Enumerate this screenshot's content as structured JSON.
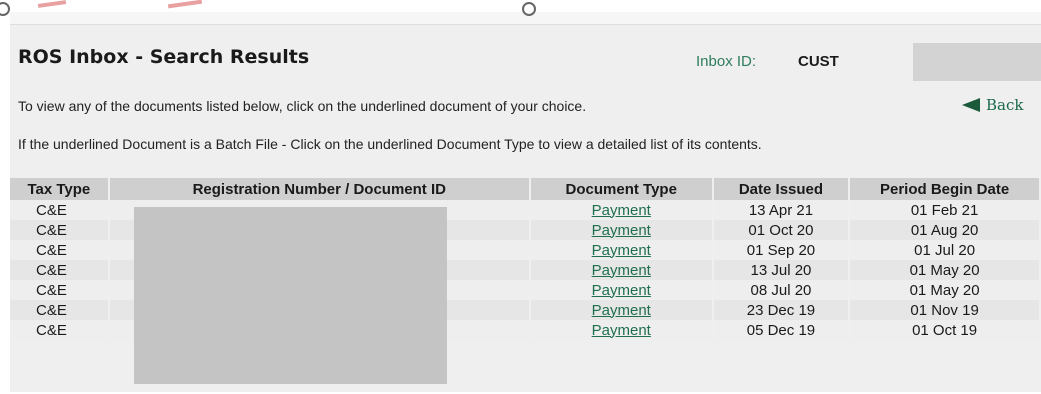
{
  "page": {
    "title": "ROS Inbox - Search Results",
    "inbox_label": "Inbox ID:",
    "inbox_value": "CUST",
    "instruction_1": "To view any of the documents listed below, click on the underlined document of your choice.",
    "instruction_2": "If the underlined Document is a Batch File - Click on the underlined Document Type to view a detailed list of its contents.",
    "back_label": "Back"
  },
  "table": {
    "headers": [
      "Tax Type",
      "Registration Number / Document ID",
      "Document Type",
      "Date Issued",
      "Period Begin Date"
    ],
    "rows": [
      {
        "tax_type": "C&E",
        "reg": "",
        "doc_type": "Payment",
        "date_issued": "13 Apr 21",
        "period_begin": "01 Feb 21"
      },
      {
        "tax_type": "C&E",
        "reg": "",
        "doc_type": "Payment",
        "date_issued": "01 Oct 20",
        "period_begin": "01 Aug 20"
      },
      {
        "tax_type": "C&E",
        "reg": "",
        "doc_type": "Payment",
        "date_issued": "01 Sep 20",
        "period_begin": "01 Jul 20"
      },
      {
        "tax_type": "C&E",
        "reg": "",
        "doc_type": "Payment",
        "date_issued": "13 Jul 20",
        "period_begin": "01 May 20"
      },
      {
        "tax_type": "C&E",
        "reg": "",
        "doc_type": "Payment",
        "date_issued": "08 Jul 20",
        "period_begin": "01 May 20"
      },
      {
        "tax_type": "C&E",
        "reg": "",
        "doc_type": "Payment",
        "date_issued": "23 Dec 19",
        "period_begin": "01 Nov 19"
      },
      {
        "tax_type": "C&E",
        "reg": "",
        "doc_type": "Payment",
        "date_issued": "05 Dec 19",
        "period_begin": "01 Oct 19"
      }
    ]
  }
}
